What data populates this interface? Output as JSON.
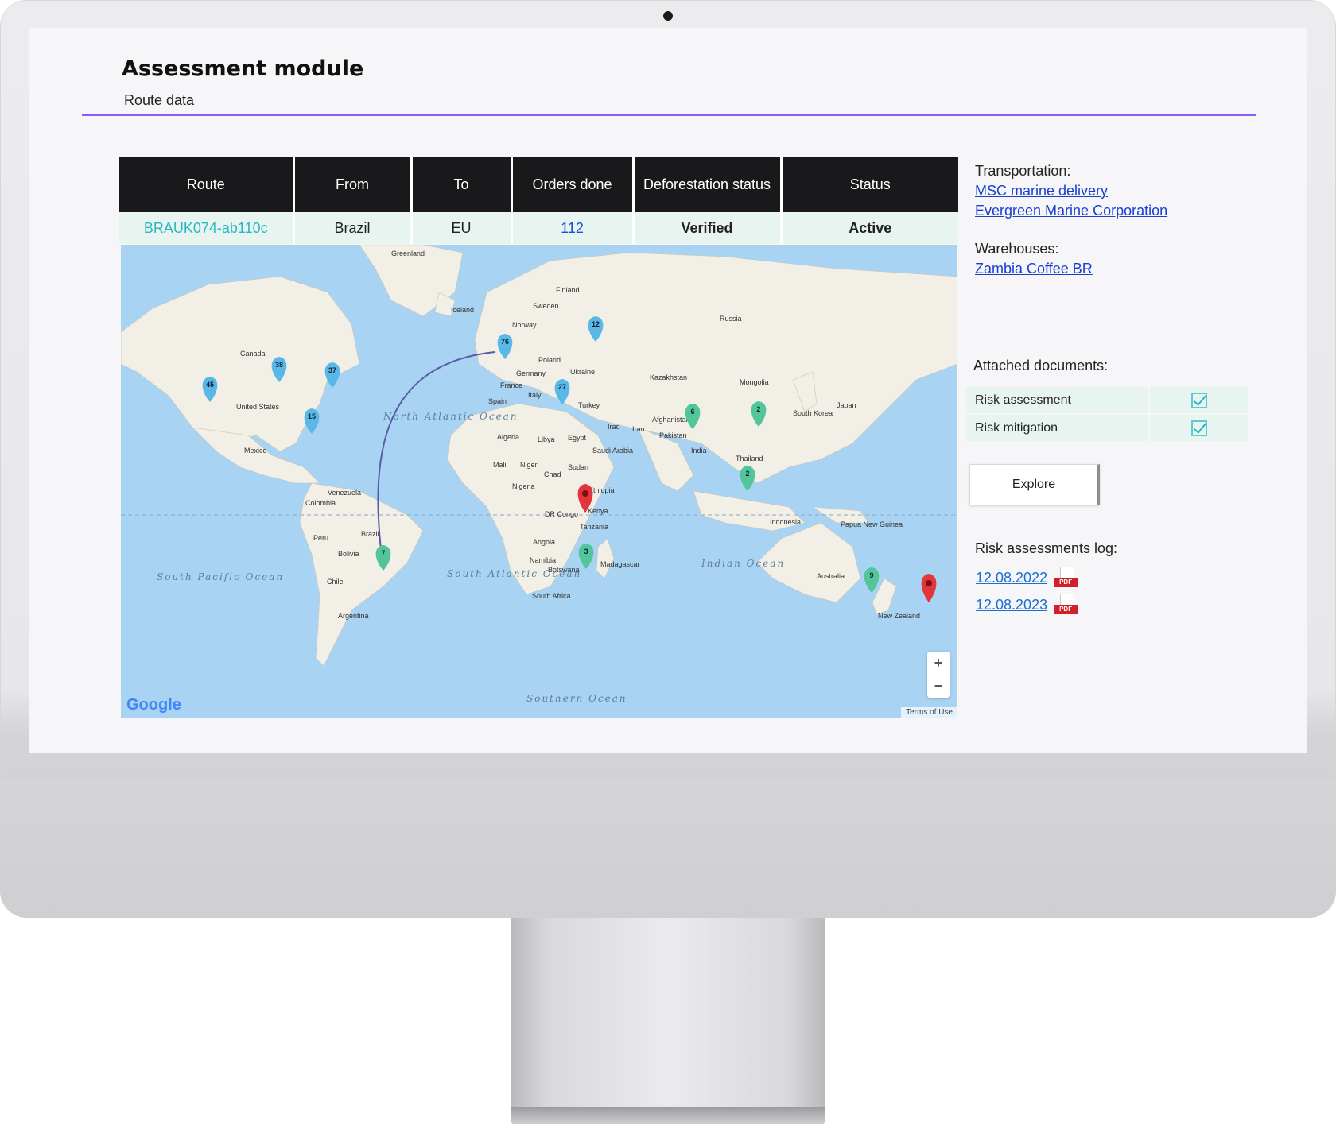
{
  "header": {
    "title": "Assessment module",
    "subtitle": "Route data"
  },
  "table": {
    "columns": [
      "Route",
      "From",
      "To",
      "Orders done",
      "Deforestation status",
      "Status"
    ],
    "row": {
      "route": "BRAUK074-ab110c",
      "from": "Brazil",
      "to": "EU",
      "orders_done": "112",
      "deforestation_status": "Verified",
      "status": "Active"
    }
  },
  "map": {
    "countries": [
      "Greenland",
      "Iceland",
      "Finland",
      "Sweden",
      "Norway",
      "Russia",
      "Canada",
      "United States",
      "Mexico",
      "Poland",
      "Germany",
      "Ukraine",
      "France",
      "Italy",
      "Spain",
      "Turkey",
      "Kazakhstan",
      "Mongolia",
      "Japan",
      "South Korea",
      "Afghanistan",
      "Iraq",
      "Iran",
      "Pakistan",
      "India",
      "Thailand",
      "Algeria",
      "Libya",
      "Egypt",
      "Saudi Arabia",
      "Mali",
      "Niger",
      "Chad",
      "Sudan",
      "Nigeria",
      "Ethiopia",
      "Kenya",
      "DR Congo",
      "Tanzania",
      "Angola",
      "Namibia",
      "Botswana",
      "Madagascar",
      "South Africa",
      "Venezuela",
      "Colombia",
      "Peru",
      "Brazil",
      "Bolivia",
      "Chile",
      "Argentina",
      "Indonesia",
      "Papua New Guinea",
      "Australia",
      "New Zealand"
    ],
    "oceans": [
      "North Atlantic Ocean",
      "South Atlantic Ocean",
      "South Pacific Ocean",
      "Indian Ocean",
      "Southern Ocean"
    ],
    "markers": [
      {
        "count": "45",
        "color": "#5ab8e8"
      },
      {
        "count": "38",
        "color": "#5ab8e8"
      },
      {
        "count": "37",
        "color": "#5ab8e8"
      },
      {
        "count": "15",
        "color": "#5ab8e8"
      },
      {
        "count": "76",
        "color": "#5ab8e8"
      },
      {
        "count": "12",
        "color": "#5ab8e8"
      },
      {
        "count": "27",
        "color": "#5ab8e8"
      },
      {
        "count": "6",
        "color": "#52c59a"
      },
      {
        "count": "2",
        "color": "#52c59a"
      },
      {
        "count": "2",
        "color": "#52c59a"
      },
      {
        "count": "7",
        "color": "#52c59a"
      },
      {
        "count": "3",
        "color": "#52c59a"
      },
      {
        "count": "9",
        "color": "#52c59a"
      }
    ],
    "alert_marker_color": "#e2363b",
    "zoom_in": "+",
    "zoom_out": "−",
    "terms": "Terms of Use",
    "provider_logo": "Google"
  },
  "sidebar": {
    "transportation_label": "Transportation:",
    "transportation": [
      "MSC marine delivery",
      "Evergreen Marine Corporation"
    ],
    "warehouses_label": "Warehouses:",
    "warehouses": [
      "Zambia Coffee BR"
    ],
    "documents_label": "Attached documents:",
    "documents": [
      {
        "name": "Risk assessment",
        "checked": true
      },
      {
        "name": "Risk mitigation",
        "checked": true
      }
    ],
    "explore_label": "Explore",
    "log_label": "Risk assessments log:",
    "log": [
      {
        "date": "12.08.2022",
        "file": "PDF"
      },
      {
        "date": "12.08.2023",
        "file": "PDF"
      }
    ]
  },
  "colors": {
    "accent_rule": "#8b5cf6",
    "header_bg": "#19191b",
    "row_bg": "#e7f4ef",
    "verified": "#2fc56b",
    "link": "#1a3fcf",
    "route_link": "#2bb6c4"
  }
}
